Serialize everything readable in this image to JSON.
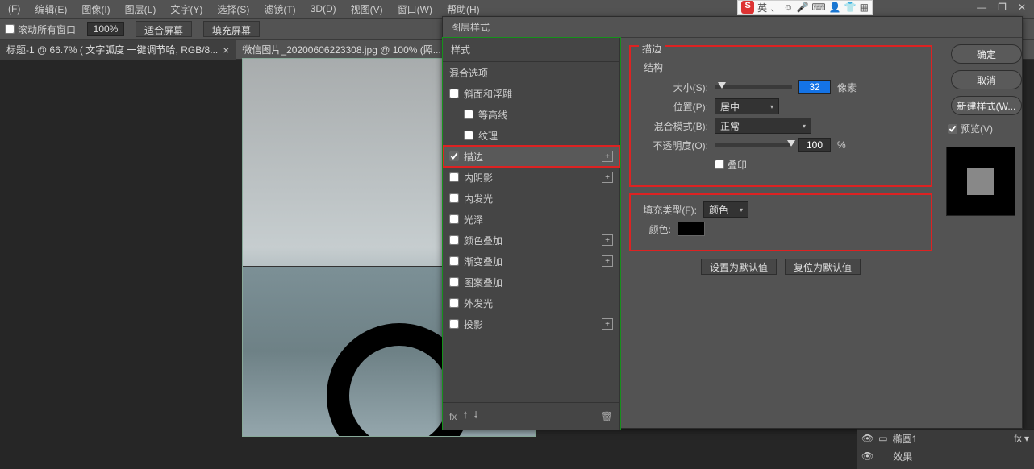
{
  "menu": [
    "(F)",
    "编辑(E)",
    "图像(I)",
    "图层(L)",
    "文字(Y)",
    "选择(S)",
    "滤镜(T)",
    "3D(D)",
    "视图(V)",
    "窗口(W)",
    "帮助(H)"
  ],
  "toolbar": {
    "scroll_all": "滚动所有窗口",
    "zoom": "100%",
    "fit_screen": "适合屏幕",
    "fill_screen": "填充屏幕"
  },
  "tabs": [
    {
      "label": "标题-1 @ 66.7% ( 文字弧度 一键调节哈, RGB/8...",
      "active": true
    },
    {
      "label": "微信图片_20200606223308.jpg @ 100% (照...",
      "active": false
    }
  ],
  "dialog": {
    "title": "图层样式",
    "left_header": "样式",
    "blend_options": "混合选项",
    "styles": [
      {
        "name": "斜面和浮雕",
        "ck": false,
        "plus": false
      },
      {
        "name": "等高线",
        "ck": false,
        "plus": false,
        "indent": true
      },
      {
        "name": "纹理",
        "ck": false,
        "plus": false,
        "indent": true
      },
      {
        "name": "描边",
        "ck": true,
        "plus": true,
        "sel": true
      },
      {
        "name": "内阴影",
        "ck": false,
        "plus": true
      },
      {
        "name": "内发光",
        "ck": false,
        "plus": false
      },
      {
        "name": "光泽",
        "ck": false,
        "plus": false
      },
      {
        "name": "颜色叠加",
        "ck": false,
        "plus": true
      },
      {
        "name": "渐变叠加",
        "ck": false,
        "plus": true
      },
      {
        "name": "图案叠加",
        "ck": false,
        "plus": false
      },
      {
        "name": "外发光",
        "ck": false,
        "plus": false
      },
      {
        "name": "投影",
        "ck": false,
        "plus": true
      }
    ],
    "stroke": {
      "section": "描边",
      "group": "结构",
      "size_label": "大小(S):",
      "size_value": "32",
      "size_unit": "像素",
      "position_label": "位置(P):",
      "position_value": "居中",
      "blend_label": "混合模式(B):",
      "blend_value": "正常",
      "opacity_label": "不透明度(O):",
      "opacity_value": "100",
      "opacity_unit": "%",
      "overprint": "叠印",
      "fill_type_label": "填充类型(F):",
      "fill_type_value": "颜色",
      "color_label": "颜色:"
    },
    "buttons": {
      "ok": "确定",
      "cancel": "取消",
      "new_style": "新建样式(W...",
      "preview": "预览(V)",
      "set_default": "设置为默认值",
      "reset_default": "复位为默认值"
    }
  },
  "layers": {
    "item": "椭圆1",
    "effects": "效果"
  },
  "ime": {
    "chars": [
      "英",
      "、",
      "☺",
      "🎤",
      "⌨",
      "👤",
      "👕",
      "▦"
    ]
  }
}
